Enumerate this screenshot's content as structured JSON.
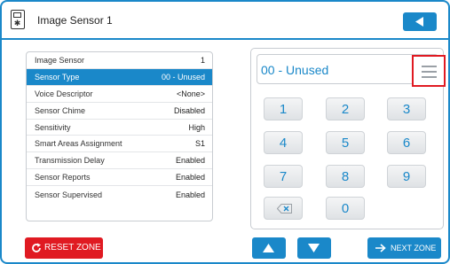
{
  "header": {
    "title": "Image Sensor 1",
    "device_icon": "sensor-device-icon",
    "back_icon": "back-arrow-icon"
  },
  "settings": [
    {
      "label": "Image Sensor",
      "value": "1",
      "selected": false
    },
    {
      "label": "Sensor Type",
      "value": "00 - Unused",
      "selected": true
    },
    {
      "label": "Voice Descriptor",
      "value": "<None>",
      "selected": false
    },
    {
      "label": "Sensor Chime",
      "value": "Disabled",
      "selected": false
    },
    {
      "label": "Sensitivity",
      "value": "High",
      "selected": false
    },
    {
      "label": "Smart Areas Assignment",
      "value": "S1",
      "selected": false
    },
    {
      "label": "Transmission Delay",
      "value": "Enabled",
      "selected": false
    },
    {
      "label": "Sensor Reports",
      "value": "Enabled",
      "selected": false
    },
    {
      "label": "Sensor Supervised",
      "value": "Enabled",
      "selected": false
    }
  ],
  "keypad": {
    "display": "00 - Unused",
    "menu_icon": "hamburger-menu-icon",
    "keys": [
      "1",
      "2",
      "3",
      "4",
      "5",
      "6",
      "7",
      "8",
      "9",
      "0"
    ],
    "backspace_icon": "backspace-icon"
  },
  "footer": {
    "reset_label": "RESET ZONE",
    "reset_icon": "reset-icon",
    "up_icon": "arrow-up-icon",
    "down_icon": "arrow-down-icon",
    "next_label": "NEXT ZONE",
    "next_icon": "arrow-right-icon"
  },
  "colors": {
    "accent": "#1a88c9",
    "danger": "#e01a22",
    "selected_row": "#1a88c9"
  }
}
